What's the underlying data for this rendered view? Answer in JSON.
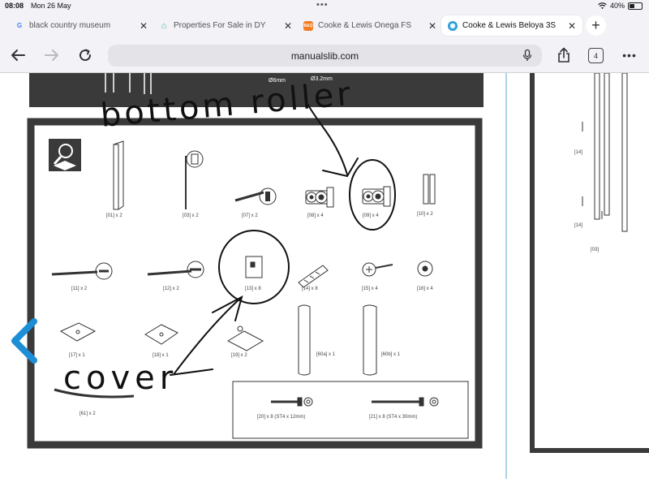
{
  "status": {
    "time": "08:08",
    "date": "Mon 26 May",
    "battery_text": "40%",
    "battery_level": 0.4
  },
  "tabs": [
    {
      "title": "black country museum",
      "favicon": "google-icon",
      "favicon_text": "G",
      "favicon_color": "#4285f4",
      "active": false
    },
    {
      "title": "Properties For Sale in DY",
      "favicon": "house-icon",
      "favicon_text": "⌂",
      "favicon_color": "#2bb7a3",
      "active": false
    },
    {
      "title": "Cooke & Lewis Onega FS",
      "favicon": "bq-icon",
      "favicon_text": "B&Q",
      "favicon_color": "#f47b20",
      "active": false
    },
    {
      "title": "Cooke & Lewis Beloya 3S",
      "favicon": "manualslib-icon",
      "favicon_text": "◉",
      "favicon_color": "#2a9fd6",
      "active": true
    }
  ],
  "toolbar": {
    "url": "manualslib.com",
    "tab_count": "4"
  },
  "diagram": {
    "top_labels": {
      "small": "Ø6mm",
      "large": "Ø3.2mm"
    },
    "parts": {
      "p01": "[01] x 2",
      "p03": "[03] x 2",
      "p07": "[07] x 2",
      "p08": "[08] x 4",
      "p09": "[09] x 4",
      "p10": "[10] x 2",
      "p11": "[11] x 2",
      "p12": "[12] x 2",
      "p13": "[13] x 8",
      "p14": "[14] x 8",
      "p15": "[15] x 4",
      "p16": "[16] x 4",
      "p17": "[17] x 1",
      "p18": "[18] x 1",
      "p19": "[19] x 2",
      "p60a": "[60a] x 1",
      "p60b": "[60b] x 1",
      "p61": "[61] x 2",
      "p20": "[20] x 8 (ST4 x 12mm)",
      "p21": "[21] x 8 (ST4 x 30mm)"
    },
    "right_labels": {
      "a": "[14]",
      "b": "[14]",
      "c": "[03]"
    },
    "annotations": {
      "note1": "bottom roller",
      "note2": "cover"
    }
  }
}
